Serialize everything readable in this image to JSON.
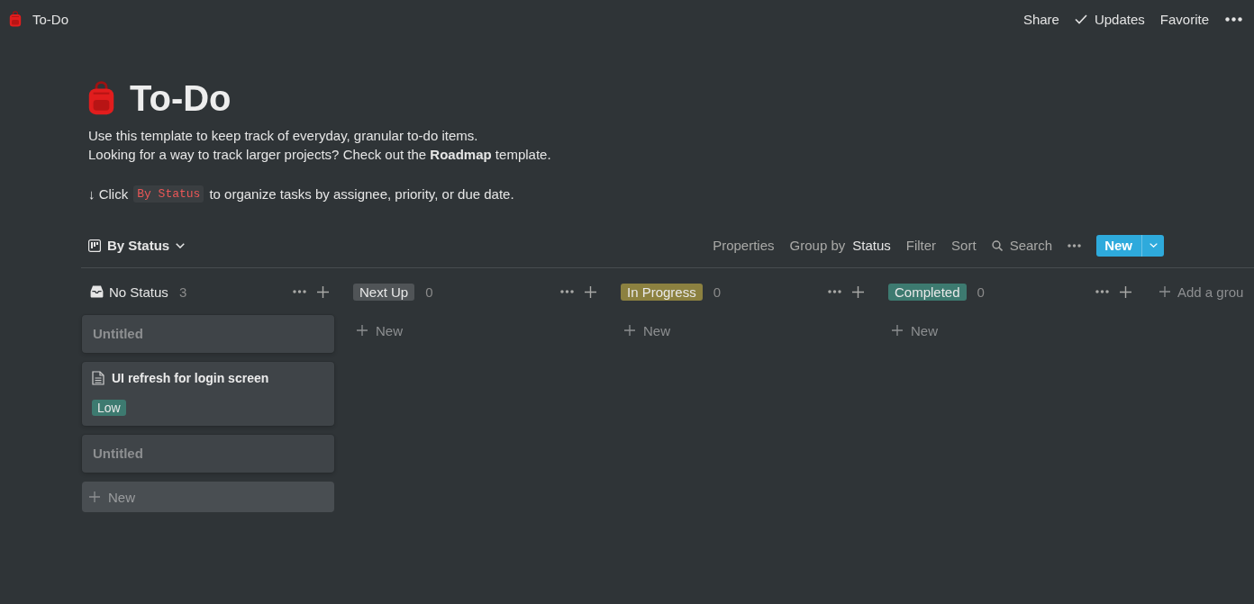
{
  "top_bar": {
    "title": "To-Do",
    "actions": [
      {
        "kind": "share",
        "label": "Share"
      },
      {
        "kind": "updates",
        "label": "Updates"
      },
      {
        "kind": "favorite",
        "label": "Favorite"
      },
      {
        "kind": "more"
      }
    ]
  },
  "page": {
    "title": "To-Do",
    "description": [
      "Use this template to keep track of everyday, granular to-do items.",
      "Looking for a way to track larger projects? Check out the **Roadmap** template."
    ],
    "hint": {
      "before": "↓ Click",
      "code": "By Status",
      "after": "to organize tasks by assignee, priority, or due date."
    }
  },
  "view": {
    "tabs": [
      {
        "label": "By Status",
        "selected": true
      }
    ],
    "toolbar": [
      {
        "kind": "properties",
        "label": "Properties"
      },
      {
        "kind": "group",
        "label": "Group by",
        "value": "Status"
      },
      {
        "kind": "filter",
        "label": "Filter"
      },
      {
        "kind": "sort",
        "label": "Sort"
      },
      {
        "kind": "search",
        "label": "Search"
      },
      {
        "kind": "more"
      }
    ],
    "new_button": {
      "label": "New"
    }
  },
  "board": {
    "columns": [
      {
        "kind": "plain",
        "label": "No Status",
        "count": "3",
        "cards": [
          {
            "kind": "empty",
            "title": "Untitled"
          },
          {
            "kind": "page",
            "title": "UI refresh for login screen",
            "tags": [
              {
                "label": "Low",
                "color": "#3d7a70"
              }
            ]
          },
          {
            "kind": "empty",
            "title": "Untitled"
          }
        ],
        "new_item": {
          "label": "New",
          "hovered": true
        }
      },
      {
        "kind": "tag",
        "label": "Next Up",
        "color": "#505457",
        "count": "0",
        "new_item": {
          "label": "New",
          "hovered": false
        }
      },
      {
        "kind": "tag",
        "label": "In Progress",
        "color": "#8c8140",
        "count": "0",
        "new_item": {
          "label": "New",
          "hovered": false
        }
      },
      {
        "kind": "tag",
        "label": "Completed",
        "color": "#3d7a70",
        "count": "0",
        "new_item": {
          "label": "New",
          "hovered": false
        }
      }
    ],
    "add_group": {
      "label": "Add a grou"
    }
  }
}
